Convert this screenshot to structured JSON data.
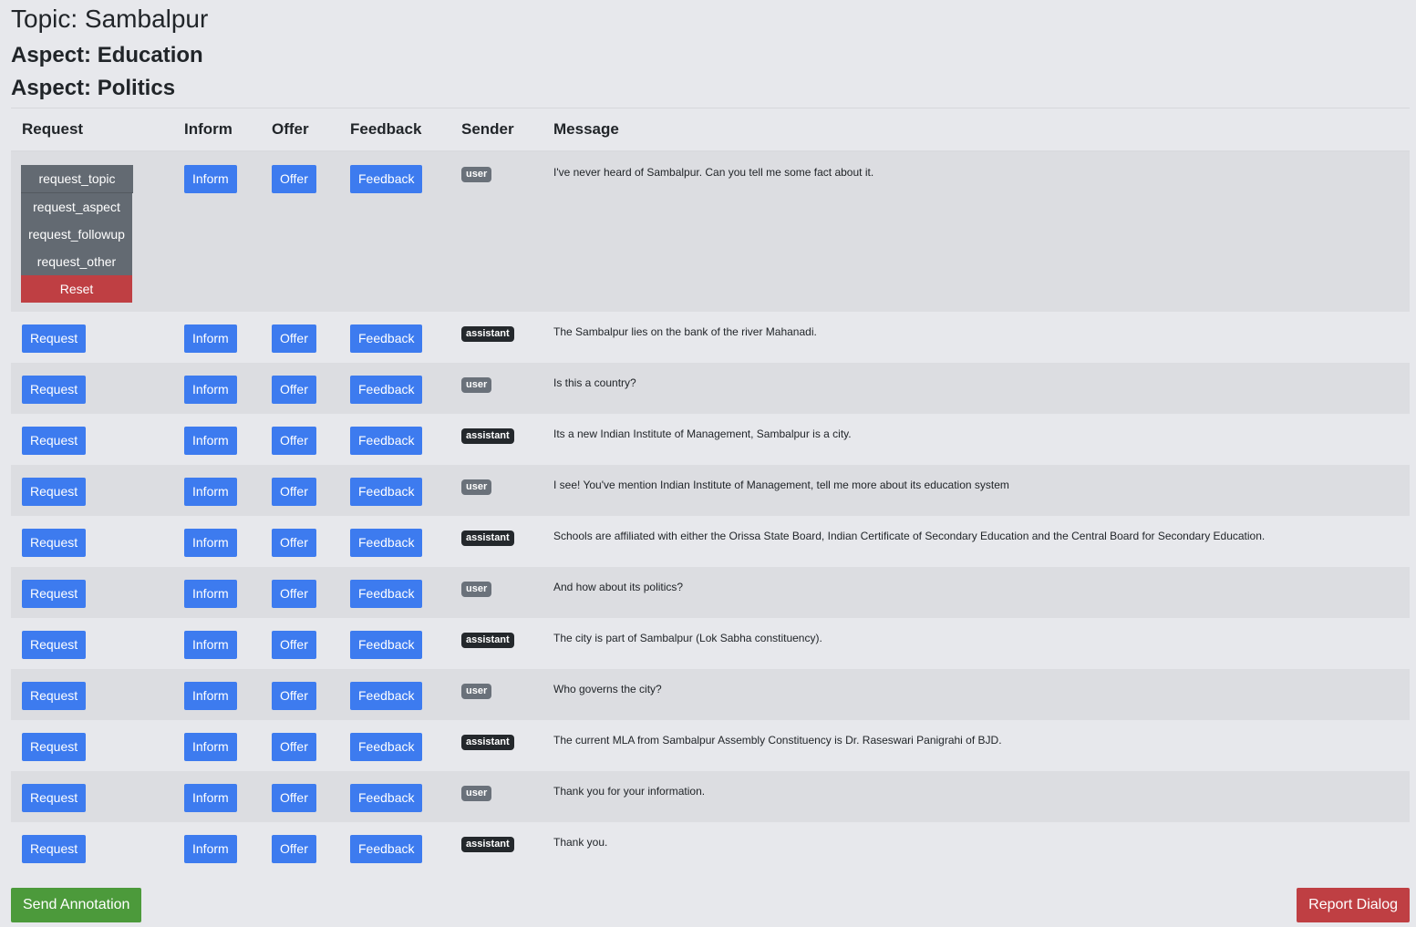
{
  "header": {
    "topic": "Topic: Sambalpur",
    "aspects": [
      "Aspect: Education",
      "Aspect: Politics"
    ]
  },
  "table": {
    "columns": [
      "Request",
      "Inform",
      "Offer",
      "Feedback",
      "Sender",
      "Message"
    ],
    "buttons": {
      "request": "Request",
      "inform": "Inform",
      "offer": "Offer",
      "feedback": "Feedback"
    },
    "request_dropdown": {
      "selected": "request_topic",
      "items": [
        "request_aspect",
        "request_followup",
        "request_other"
      ],
      "reset": "Reset"
    },
    "rows": [
      {
        "sender": "user",
        "message": "I've never heard of Sambalpur. Can you tell me some fact about it."
      },
      {
        "sender": "assistant",
        "message": "The Sambalpur lies on the bank of the river Mahanadi."
      },
      {
        "sender": "user",
        "message": "Is this a country?"
      },
      {
        "sender": "assistant",
        "message": "Its a new Indian Institute of Management, Sambalpur is a city."
      },
      {
        "sender": "user",
        "message": "I see! You've mention Indian Institute of Management, tell me more about its education system"
      },
      {
        "sender": "assistant",
        "message": "Schools are affiliated with either the Orissa State Board, Indian Certificate of Secondary Education and the Central Board for Secondary Education."
      },
      {
        "sender": "user",
        "message": "And how about its politics?"
      },
      {
        "sender": "assistant",
        "message": "The city is part of Sambalpur (Lok Sabha constituency)."
      },
      {
        "sender": "user",
        "message": "Who governs the city?"
      },
      {
        "sender": "assistant",
        "message": "The current MLA from Sambalpur Assembly Constituency is Dr. Raseswari Panigrahi of BJD."
      },
      {
        "sender": "user",
        "message": "Thank you for your information."
      },
      {
        "sender": "assistant",
        "message": "Thank you."
      }
    ]
  },
  "footer": {
    "send": "Send Annotation",
    "report": "Report Dialog"
  },
  "colors": {
    "primary_button": "#3d7bef",
    "dropdown_bg": "#636a72",
    "danger": "#bf3f43",
    "success": "#4c9a3b",
    "badge_user": "#6a717a",
    "badge_assistant": "#24282c",
    "page_bg": "#e7e8ec",
    "stripe_bg": "#dcdde1"
  }
}
